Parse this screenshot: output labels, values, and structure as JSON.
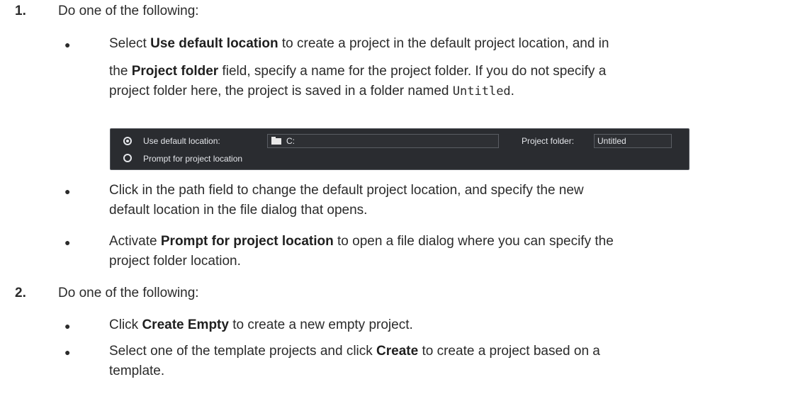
{
  "step1": {
    "number": "1.",
    "intro": "Do one of the following:",
    "bullet1": {
      "pre": "Select ",
      "bold1": "Use default location",
      "mid1": " to create a project in the default project location, and in",
      "line2_pre": "the ",
      "bold2": "Project folder",
      "line2_post": " field, specify a name for the project folder. If you do not specify a",
      "line3_pre": "project folder here, the project is saved in a folder named ",
      "code": "Untitled",
      "line3_post": "."
    },
    "bullet2": {
      "line1": "Click in the path field to change the default project location, and specify the new",
      "line2": "default location in the file dialog that opens."
    },
    "bullet3": {
      "pre": "Activate ",
      "bold": "Prompt for project location",
      "post": " to open a file dialog where you can specify the",
      "line2": "project folder location."
    }
  },
  "panel": {
    "use_default_label": "Use default location:",
    "path_value": "C:",
    "project_folder_label": "Project folder:",
    "project_folder_value": "Untitled",
    "prompt_label": "Prompt for project location",
    "selected_option": "Use default location:"
  },
  "step2": {
    "number": "2.",
    "intro": "Do one of the following:",
    "bullet1": {
      "pre": "Click ",
      "bold": "Create Empty",
      "post": " to create a new empty project."
    },
    "bullet2": {
      "pre": "Select one of the template projects and click ",
      "bold": "Create",
      "post": " to create a project based on a",
      "line2": "template."
    }
  },
  "bullet_glyph": "●"
}
